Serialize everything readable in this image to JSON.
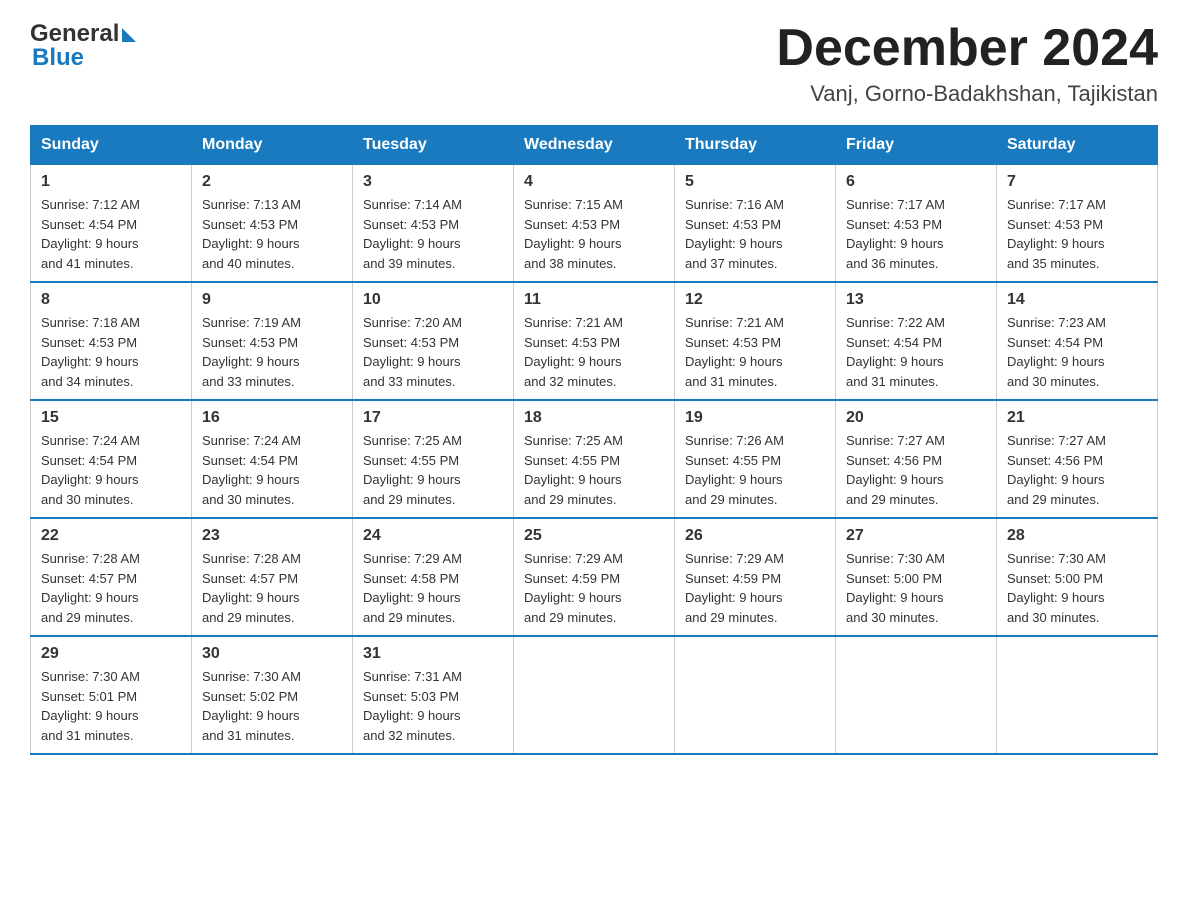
{
  "header": {
    "logo_general": "General",
    "logo_blue": "Blue",
    "month_title": "December 2024",
    "location": "Vanj, Gorno-Badakhshan, Tajikistan"
  },
  "weekdays": [
    "Sunday",
    "Monday",
    "Tuesday",
    "Wednesday",
    "Thursday",
    "Friday",
    "Saturday"
  ],
  "weeks": [
    [
      {
        "day": "1",
        "sunrise": "7:12 AM",
        "sunset": "4:54 PM",
        "daylight": "9 hours and 41 minutes."
      },
      {
        "day": "2",
        "sunrise": "7:13 AM",
        "sunset": "4:53 PM",
        "daylight": "9 hours and 40 minutes."
      },
      {
        "day": "3",
        "sunrise": "7:14 AM",
        "sunset": "4:53 PM",
        "daylight": "9 hours and 39 minutes."
      },
      {
        "day": "4",
        "sunrise": "7:15 AM",
        "sunset": "4:53 PM",
        "daylight": "9 hours and 38 minutes."
      },
      {
        "day": "5",
        "sunrise": "7:16 AM",
        "sunset": "4:53 PM",
        "daylight": "9 hours and 37 minutes."
      },
      {
        "day": "6",
        "sunrise": "7:17 AM",
        "sunset": "4:53 PM",
        "daylight": "9 hours and 36 minutes."
      },
      {
        "day": "7",
        "sunrise": "7:17 AM",
        "sunset": "4:53 PM",
        "daylight": "9 hours and 35 minutes."
      }
    ],
    [
      {
        "day": "8",
        "sunrise": "7:18 AM",
        "sunset": "4:53 PM",
        "daylight": "9 hours and 34 minutes."
      },
      {
        "day": "9",
        "sunrise": "7:19 AM",
        "sunset": "4:53 PM",
        "daylight": "9 hours and 33 minutes."
      },
      {
        "day": "10",
        "sunrise": "7:20 AM",
        "sunset": "4:53 PM",
        "daylight": "9 hours and 33 minutes."
      },
      {
        "day": "11",
        "sunrise": "7:21 AM",
        "sunset": "4:53 PM",
        "daylight": "9 hours and 32 minutes."
      },
      {
        "day": "12",
        "sunrise": "7:21 AM",
        "sunset": "4:53 PM",
        "daylight": "9 hours and 31 minutes."
      },
      {
        "day": "13",
        "sunrise": "7:22 AM",
        "sunset": "4:54 PM",
        "daylight": "9 hours and 31 minutes."
      },
      {
        "day": "14",
        "sunrise": "7:23 AM",
        "sunset": "4:54 PM",
        "daylight": "9 hours and 30 minutes."
      }
    ],
    [
      {
        "day": "15",
        "sunrise": "7:24 AM",
        "sunset": "4:54 PM",
        "daylight": "9 hours and 30 minutes."
      },
      {
        "day": "16",
        "sunrise": "7:24 AM",
        "sunset": "4:54 PM",
        "daylight": "9 hours and 30 minutes."
      },
      {
        "day": "17",
        "sunrise": "7:25 AM",
        "sunset": "4:55 PM",
        "daylight": "9 hours and 29 minutes."
      },
      {
        "day": "18",
        "sunrise": "7:25 AM",
        "sunset": "4:55 PM",
        "daylight": "9 hours and 29 minutes."
      },
      {
        "day": "19",
        "sunrise": "7:26 AM",
        "sunset": "4:55 PM",
        "daylight": "9 hours and 29 minutes."
      },
      {
        "day": "20",
        "sunrise": "7:27 AM",
        "sunset": "4:56 PM",
        "daylight": "9 hours and 29 minutes."
      },
      {
        "day": "21",
        "sunrise": "7:27 AM",
        "sunset": "4:56 PM",
        "daylight": "9 hours and 29 minutes."
      }
    ],
    [
      {
        "day": "22",
        "sunrise": "7:28 AM",
        "sunset": "4:57 PM",
        "daylight": "9 hours and 29 minutes."
      },
      {
        "day": "23",
        "sunrise": "7:28 AM",
        "sunset": "4:57 PM",
        "daylight": "9 hours and 29 minutes."
      },
      {
        "day": "24",
        "sunrise": "7:29 AM",
        "sunset": "4:58 PM",
        "daylight": "9 hours and 29 minutes."
      },
      {
        "day": "25",
        "sunrise": "7:29 AM",
        "sunset": "4:59 PM",
        "daylight": "9 hours and 29 minutes."
      },
      {
        "day": "26",
        "sunrise": "7:29 AM",
        "sunset": "4:59 PM",
        "daylight": "9 hours and 29 minutes."
      },
      {
        "day": "27",
        "sunrise": "7:30 AM",
        "sunset": "5:00 PM",
        "daylight": "9 hours and 30 minutes."
      },
      {
        "day": "28",
        "sunrise": "7:30 AM",
        "sunset": "5:00 PM",
        "daylight": "9 hours and 30 minutes."
      }
    ],
    [
      {
        "day": "29",
        "sunrise": "7:30 AM",
        "sunset": "5:01 PM",
        "daylight": "9 hours and 31 minutes."
      },
      {
        "day": "30",
        "sunrise": "7:30 AM",
        "sunset": "5:02 PM",
        "daylight": "9 hours and 31 minutes."
      },
      {
        "day": "31",
        "sunrise": "7:31 AM",
        "sunset": "5:03 PM",
        "daylight": "9 hours and 32 minutes."
      },
      null,
      null,
      null,
      null
    ]
  ],
  "labels": {
    "sunrise": "Sunrise:",
    "sunset": "Sunset:",
    "daylight": "Daylight:"
  }
}
